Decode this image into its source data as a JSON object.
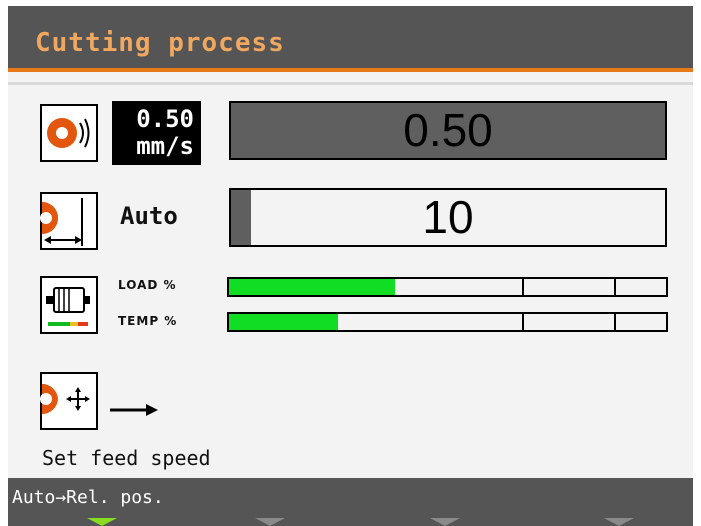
{
  "header": {
    "title": "Cutting process"
  },
  "feed_speed": {
    "badge_value": "0.50",
    "badge_unit": "mm/s",
    "display_value": "0.50"
  },
  "depth": {
    "mode_label": "Auto",
    "display_value": "10"
  },
  "motor": {
    "load": {
      "label": "LOAD %",
      "fraction": 0.38
    },
    "temp": {
      "label": "TEMP %",
      "fraction": 0.25
    }
  },
  "hint": {
    "text": "Set feed speed"
  },
  "footer": {
    "label": "Auto→Rel. pos.",
    "softkeys": [
      "active",
      "inactive",
      "inactive",
      "inactive"
    ]
  },
  "colors": {
    "header_bg": "#555555",
    "accent_orange": "#e87a1a",
    "bar_fill_green": "#11dd22",
    "softkey_active": "#88dd22"
  },
  "icons": [
    "blade-speed-icon",
    "blade-depth-icon",
    "motor-icon",
    "blade-move-icon",
    "arrow-right-icon"
  ]
}
